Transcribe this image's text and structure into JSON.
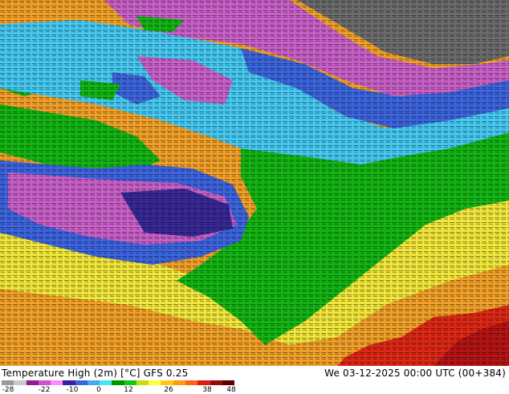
{
  "title": {
    "left": "Temperature High (2m) [°C] GFS 0.25",
    "right": "We 03-12-2025 00:00 UTC (00+384)"
  },
  "legend": {
    "ticks": [
      "-28",
      "-22",
      "-10",
      "0",
      "12",
      "26",
      "38",
      "48"
    ],
    "colors": [
      "#9a9a9a",
      "#c8c8c8",
      "#8a1e8a",
      "#d24fd2",
      "#ff8cff",
      "#3a1ea8",
      "#3c64dc",
      "#46aaf0",
      "#46e6f0",
      "#009600",
      "#14c814",
      "#c8dc14",
      "#ffff3c",
      "#ffc814",
      "#ff9614",
      "#ff6414",
      "#dc1e14",
      "#960a0a",
      "#5a0000"
    ]
  },
  "map": {
    "region": "Europe",
    "palette": {
      "gray": "#6b6b6b",
      "purple": "#c860c8",
      "blue": "#3c64dc",
      "cyan": "#46c8f0",
      "green": "#14b414",
      "yellow": "#f0e63c",
      "orange": "#f0a028",
      "red": "#dc2814",
      "navy": "#1e1e8c",
      "magenta": "#a03ca0"
    }
  }
}
